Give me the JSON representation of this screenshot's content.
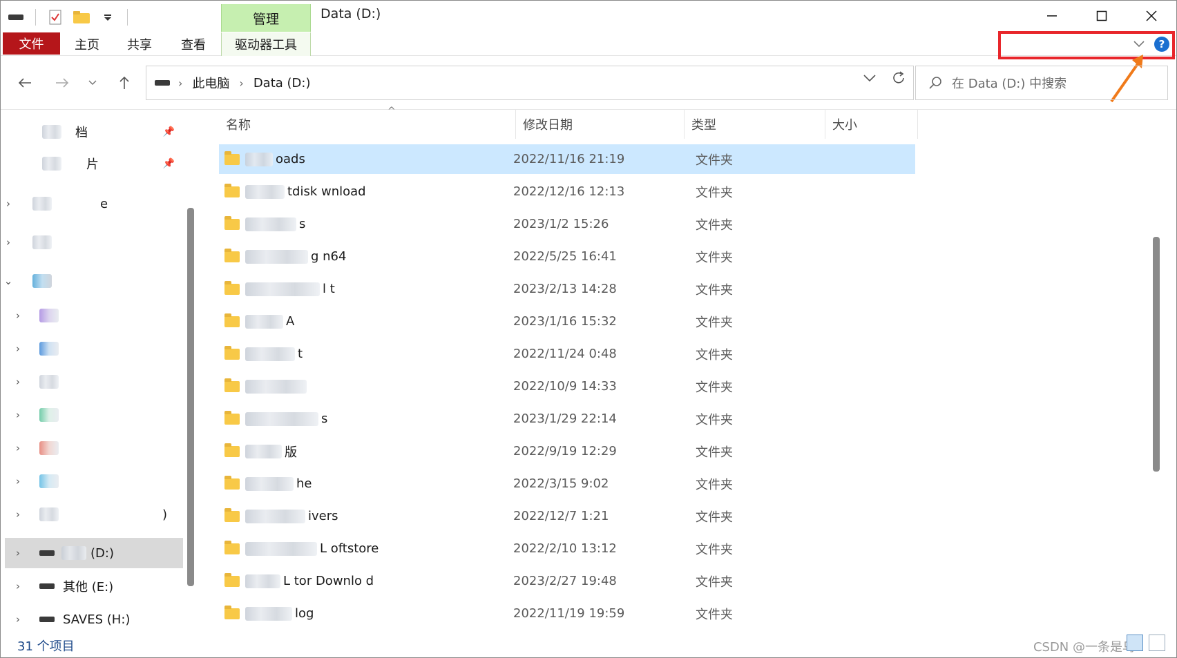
{
  "title_bar": {
    "manage_tab": "管理",
    "window_title": "Data (D:)"
  },
  "ribbon": {
    "tabs": [
      "文件",
      "主页",
      "共享",
      "查看",
      "驱动器工具"
    ]
  },
  "address_bar": {
    "crumbs": [
      "此电脑",
      "Data (D:)"
    ]
  },
  "search": {
    "placeholder": "在 Data (D:) 中搜索"
  },
  "sidebar": {
    "items": [
      {
        "label": "档",
        "pinned": true
      },
      {
        "label": "片",
        "pinned": true
      },
      {
        "label": "e"
      },
      {
        "label": ""
      },
      {
        "label": ""
      },
      {
        "label": ""
      },
      {
        "label": ""
      },
      {
        "label": ""
      },
      {
        "label": ""
      },
      {
        "label": ""
      },
      {
        "label": ""
      },
      {
        "label": ")"
      },
      {
        "label": "(D:)",
        "selected": true
      },
      {
        "label": "其他 (E:)"
      },
      {
        "label": "SAVES (H:)"
      }
    ]
  },
  "columns": {
    "name": "名称",
    "date": "修改日期",
    "type": "类型",
    "size": "大小"
  },
  "files": [
    {
      "name": "oads",
      "date": "2022/11/16 21:19",
      "type": "文件夹",
      "selected": true
    },
    {
      "name": "tdisk  wnload",
      "date": "2022/12/16 12:13",
      "type": "文件夹"
    },
    {
      "name": "s",
      "date": "2023/1/2 15:26",
      "type": "文件夹"
    },
    {
      "name": "g   n64",
      "date": "2022/5/25 16:41",
      "type": "文件夹"
    },
    {
      "name": "l t",
      "date": "2023/2/13 14:28",
      "type": "文件夹"
    },
    {
      "name": "A",
      "date": "2023/1/16 15:32",
      "type": "文件夹"
    },
    {
      "name": "t",
      "date": "2022/11/24 0:48",
      "type": "文件夹"
    },
    {
      "name": "",
      "date": "2022/10/9 14:33",
      "type": "文件夹"
    },
    {
      "name": "s",
      "date": "2023/1/29 22:14",
      "type": "文件夹"
    },
    {
      "name": "版",
      "date": "2022/9/19 12:29",
      "type": "文件夹"
    },
    {
      "name": "he",
      "date": "2022/3/15 9:02",
      "type": "文件夹"
    },
    {
      "name": "ivers",
      "date": "2022/12/7 1:21",
      "type": "文件夹"
    },
    {
      "name": "L   oftstore",
      "date": "2022/2/10 13:12",
      "type": "文件夹"
    },
    {
      "name": "L tor  Downlo d",
      "date": "2023/2/27 19:48",
      "type": "文件夹"
    },
    {
      "name": "log",
      "date": "2022/11/19 19:59",
      "type": "文件夹"
    }
  ],
  "status": {
    "count": "31 个项目"
  },
  "watermark": "CSDN @一条是鸟",
  "colors": {
    "file_tab": "#b5161a",
    "manage_tab": "#c6efb0",
    "selected_row": "#cce8ff",
    "highlight": "#e8262b",
    "help": "#1a6fd0"
  }
}
